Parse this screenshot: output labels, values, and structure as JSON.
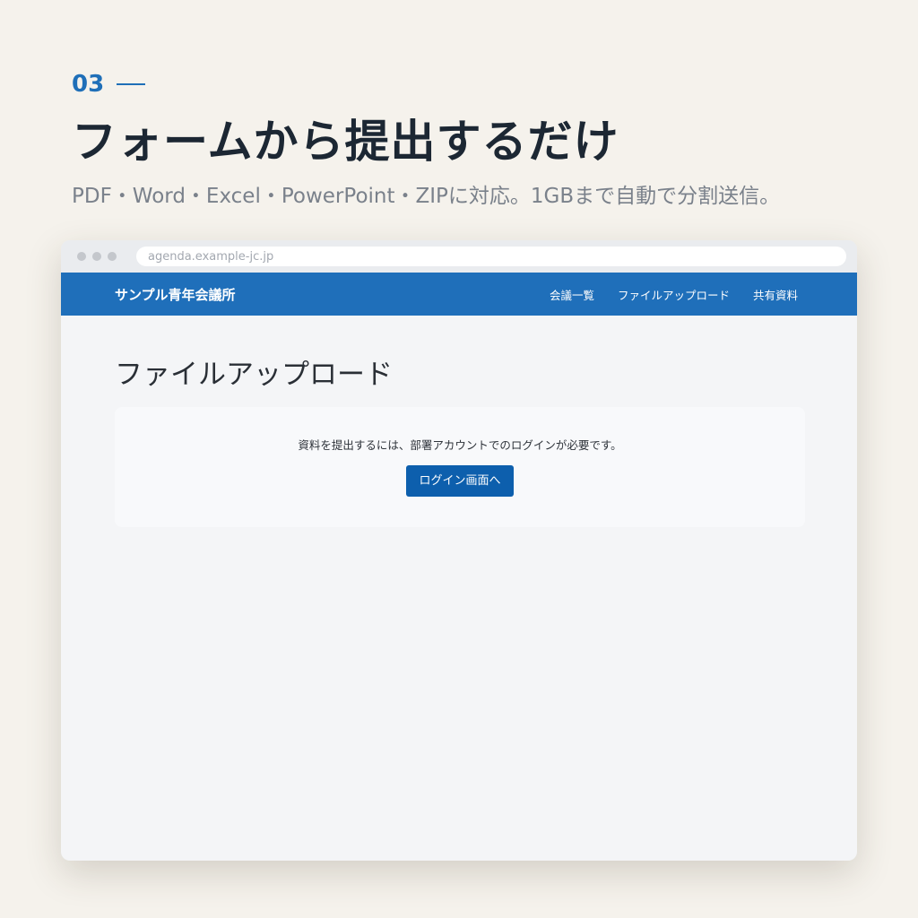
{
  "hero": {
    "step_number": "03",
    "headline": "フォームから提出するだけ",
    "subline": "PDF・Word・Excel・PowerPoint・ZIPに対応。1GBまで自動で分割送信。"
  },
  "browser": {
    "url": "agenda.example-jc.jp"
  },
  "site": {
    "brand": "サンプル青年会議所",
    "nav": [
      {
        "label": "会議一覧"
      },
      {
        "label": "ファイルアップロード"
      },
      {
        "label": "共有資料"
      }
    ]
  },
  "page": {
    "title": "ファイルアップロード",
    "notice": "資料を提出するには、部署アカウントでのログインが必要です。",
    "login_button": "ログイン画面へ"
  },
  "colors": {
    "accent": "#1f6fb8",
    "navbar": "#1f6fba",
    "button": "#0d5fad",
    "background": "#f5f2ec"
  }
}
